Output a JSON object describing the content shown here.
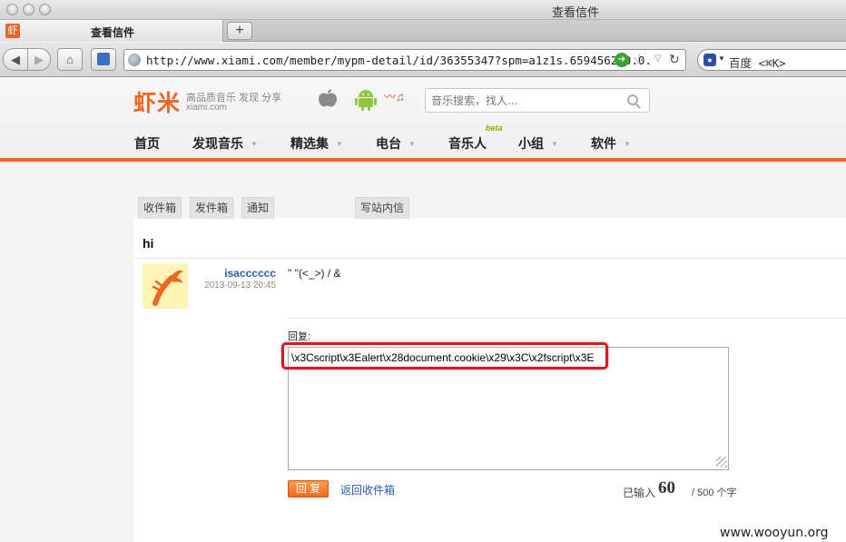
{
  "browser": {
    "window_title": "查看信件",
    "tab_title": "查看信件",
    "tab_favicon": "虾",
    "new_tab_label": "+",
    "url": "http://www.xiami.com/member/mypm-detail/id/36355347?spm=a1z1s.6594562.0.0.",
    "search_engine_placeholder": "百度 <⌘K>",
    "icons": [
      "back-icon",
      "forward-icon",
      "home-icon",
      "bookmark-icon",
      "globe-icon",
      "go-icon",
      "star-icon",
      "reload-icon",
      "baidu-paw-icon"
    ]
  },
  "site": {
    "logo_text": "虾米",
    "slogan": "高品质音乐 发现 分享",
    "domain": "xiami.com",
    "search_placeholder": "音乐搜索，找人...",
    "menu": [
      {
        "label": "首页",
        "has_arrow": false
      },
      {
        "label": "发现音乐",
        "has_arrow": true
      },
      {
        "label": "精选集",
        "has_arrow": true
      },
      {
        "label": "电台",
        "has_arrow": true
      },
      {
        "label": "音乐人",
        "has_arrow": false
      },
      {
        "label": "小组",
        "has_arrow": true
      },
      {
        "label": "软件",
        "has_arrow": true
      }
    ],
    "beta_badge": "beta",
    "accent_color": "#f06522"
  },
  "mailbox": {
    "tabs": [
      "收件箱",
      "发件箱",
      "通知",
      "写站内信"
    ],
    "subject": "hi",
    "message": {
      "sender": "isacccccc",
      "date": "2013-09-13 20:45",
      "body": "\" \"(<_>) / &"
    },
    "reply": {
      "label": "回复:",
      "value": "\\x3Cscript\\x3Ealert\\x28document.cookie\\x29\\x3C\\x2fscript\\x3E",
      "submit_label": "回 复",
      "back_label": "返回收件箱",
      "count_prefix": "已输入",
      "count_value": "60",
      "count_suffix": "/ 500 个字"
    }
  },
  "watermark": "www.wooyun.org"
}
